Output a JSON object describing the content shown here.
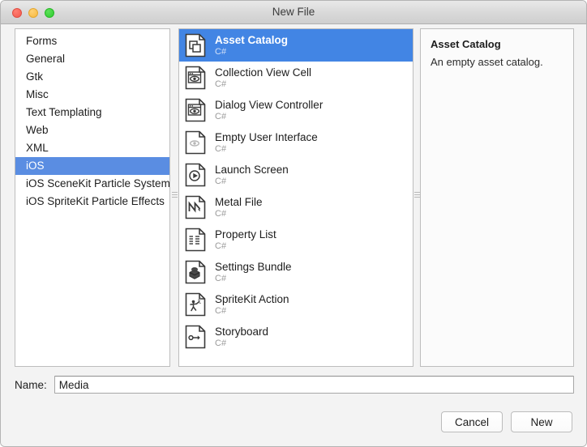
{
  "window": {
    "title": "New File",
    "traffic_lights": [
      {
        "name": "close-button",
        "color": "#f2584c"
      },
      {
        "name": "minimize-button",
        "color": "#f7b93e"
      },
      {
        "name": "zoom-button",
        "color": "#2ecc2e"
      }
    ]
  },
  "sidebar": {
    "items": [
      {
        "label": "Forms",
        "selected": false
      },
      {
        "label": "General",
        "selected": false
      },
      {
        "label": "Gtk",
        "selected": false
      },
      {
        "label": "Misc",
        "selected": false
      },
      {
        "label": "Text Templating",
        "selected": false
      },
      {
        "label": "Web",
        "selected": false
      },
      {
        "label": "XML",
        "selected": false
      },
      {
        "label": "iOS",
        "selected": true
      },
      {
        "label": "iOS SceneKit Particle Systems",
        "selected": false
      },
      {
        "label": "iOS SpriteKit Particle Effects",
        "selected": false
      }
    ],
    "selection_color": "#5a8de2"
  },
  "templates": {
    "selection_color": "#4285e4",
    "items": [
      {
        "name": "Asset Catalog",
        "language": "C#",
        "icon": "asset-catalog-icon",
        "selected": true
      },
      {
        "name": "Collection View Cell",
        "language": "C#",
        "icon": "collection-view-cell-icon",
        "selected": false
      },
      {
        "name": "Dialog View Controller",
        "language": "C#",
        "icon": "dialog-view-controller-icon",
        "selected": false
      },
      {
        "name": "Empty User Interface",
        "language": "C#",
        "icon": "empty-user-interface-icon",
        "selected": false
      },
      {
        "name": "Launch Screen",
        "language": "C#",
        "icon": "launch-screen-icon",
        "selected": false
      },
      {
        "name": "Metal File",
        "language": "C#",
        "icon": "metal-file-icon",
        "selected": false
      },
      {
        "name": "Property List",
        "language": "C#",
        "icon": "property-list-icon",
        "selected": false
      },
      {
        "name": "Settings Bundle",
        "language": "C#",
        "icon": "settings-bundle-icon",
        "selected": false
      },
      {
        "name": "SpriteKit Action",
        "language": "C#",
        "icon": "spritekit-action-icon",
        "selected": false
      },
      {
        "name": "Storyboard",
        "language": "C#",
        "icon": "storyboard-icon",
        "selected": false
      }
    ]
  },
  "detail": {
    "title": "Asset Catalog",
    "description": "An empty asset catalog."
  },
  "name_field": {
    "label": "Name:",
    "value": "Media",
    "placeholder": ""
  },
  "footer": {
    "cancel_label": "Cancel",
    "new_label": "New"
  }
}
